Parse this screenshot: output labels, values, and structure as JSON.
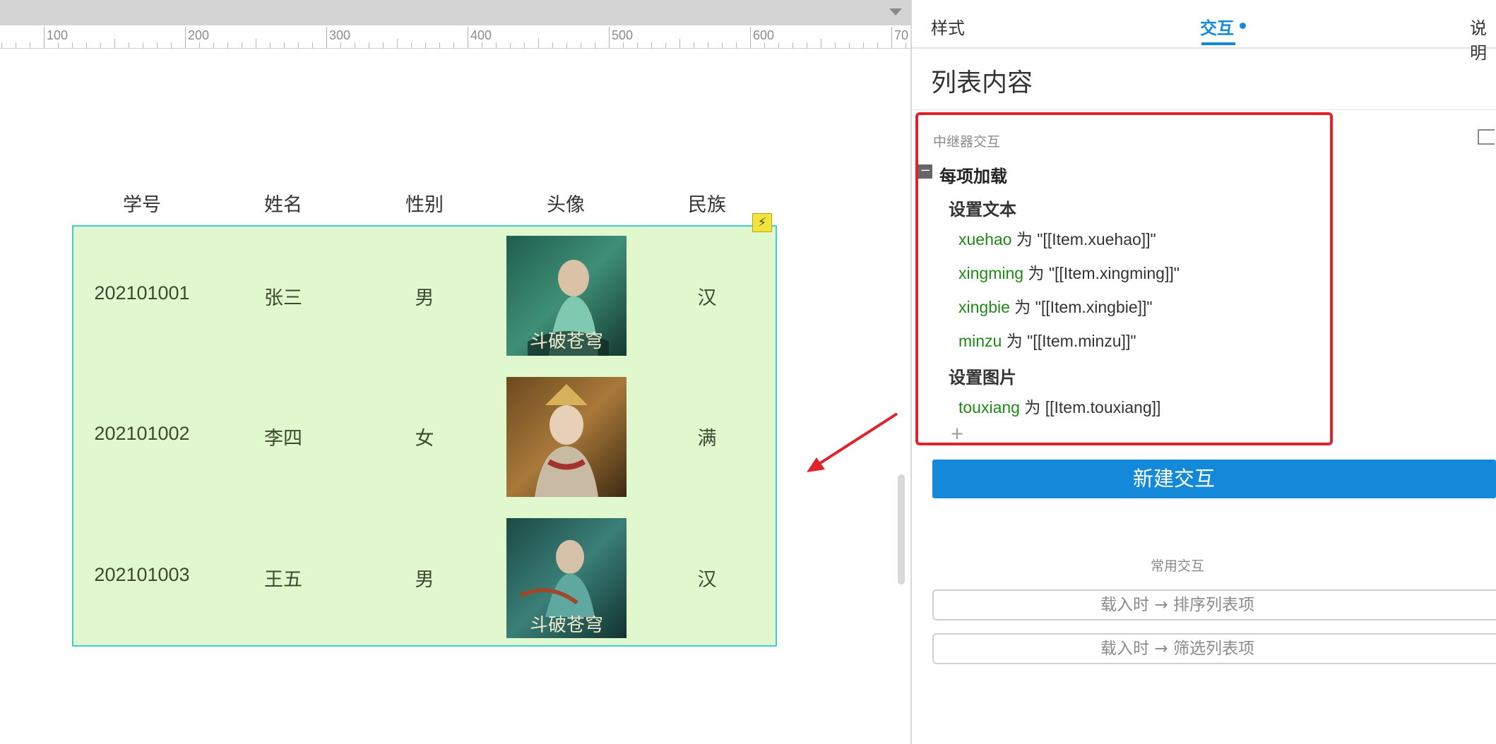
{
  "ruler": {
    "labels": [
      "100",
      "200",
      "300",
      "400",
      "500",
      "600",
      "70"
    ]
  },
  "table": {
    "headers": [
      "学号",
      "姓名",
      "性别",
      "头像",
      "民族"
    ],
    "rows": [
      {
        "xuehao": "202101001",
        "xingming": "张三",
        "xingbie": "男",
        "minzu": "汉",
        "avatar": "avatar-image-1"
      },
      {
        "xuehao": "202101002",
        "xingming": "李四",
        "xingbie": "女",
        "minzu": "满",
        "avatar": "avatar-image-2"
      },
      {
        "xuehao": "202101003",
        "xingming": "王五",
        "xingbie": "男",
        "minzu": "汉",
        "avatar": "avatar-image-3"
      }
    ],
    "repeater_badge_icon": "lightning-icon"
  },
  "panel": {
    "tabs": [
      {
        "label": "样式",
        "active": false
      },
      {
        "label": "交互",
        "active": true
      },
      {
        "label": "说明",
        "active": false
      }
    ],
    "title": "列表内容",
    "section_label": "中继器交互",
    "event": {
      "name": "每项加载",
      "collapse_symbol": "−",
      "actions": [
        {
          "name": "设置文本",
          "lines": [
            {
              "var": "xuehao",
              "op": " 为 ",
              "value": "\"[[Item.xuehao]]\""
            },
            {
              "var": "xingming",
              "op": " 为 ",
              "value": "\"[[Item.xingming]]\""
            },
            {
              "var": "xingbie",
              "op": " 为 ",
              "value": "\"[[Item.xingbie]]\""
            },
            {
              "var": "minzu",
              "op": " 为 ",
              "value": "\"[[Item.minzu]]\""
            }
          ]
        },
        {
          "name": "设置图片",
          "lines": [
            {
              "var": "touxiang",
              "op": " 为 ",
              "value": "[[Item.touxiang]]"
            }
          ]
        }
      ],
      "add_symbol": "+"
    },
    "new_interaction_label": "新建交互",
    "common_label": "常用交互",
    "common_buttons": [
      "载入时 → 排序列表项",
      "载入时 → 筛选列表项"
    ]
  },
  "colors": {
    "accent": "#1488d9",
    "repeater_bg": "#e1f8cf",
    "repeater_border": "#3ccfd1",
    "highlight_box": "#e0232a",
    "variable_text": "#1e8a15"
  }
}
